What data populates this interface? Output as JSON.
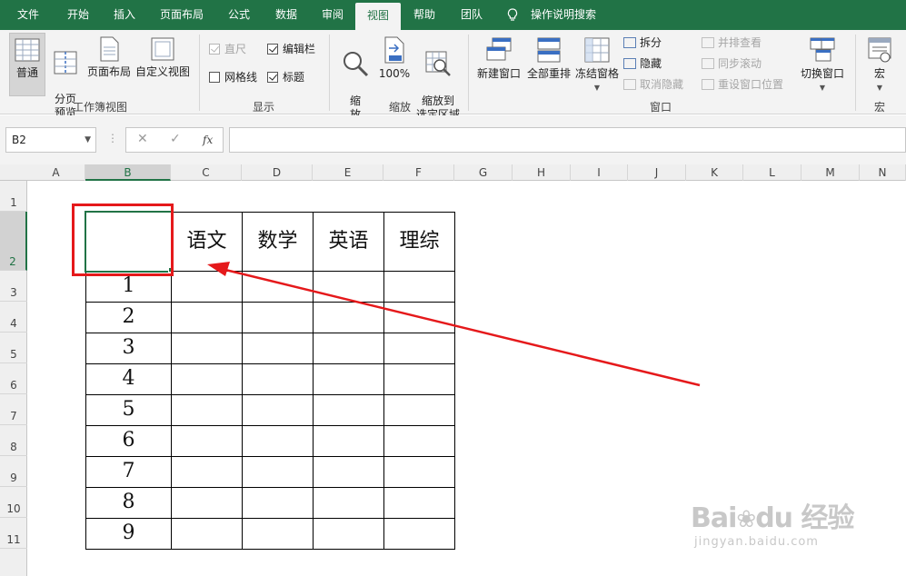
{
  "tabs": [
    {
      "label": "文件"
    },
    {
      "label": "开始"
    },
    {
      "label": "插入"
    },
    {
      "label": "页面布局"
    },
    {
      "label": "公式"
    },
    {
      "label": "数据"
    },
    {
      "label": "审阅"
    },
    {
      "label": "视图"
    },
    {
      "label": "帮助"
    },
    {
      "label": "团队"
    }
  ],
  "active_tab": "视图",
  "tell_me": "操作说明搜索",
  "ribbon": {
    "workbook_views": {
      "label": "工作簿视图",
      "normal": "普通",
      "page_break_preview": "分页\n预览",
      "page_layout": "页面布局",
      "custom_views": "自定义视图"
    },
    "show": {
      "label": "显示",
      "ruler": "直尺",
      "formula_bar": "编辑栏",
      "gridlines": "网格线",
      "headings": "标题"
    },
    "zoom": {
      "label": "缩放",
      "zoom": "缩\n放",
      "hundred": "100%",
      "zoom_to_selection": "缩放到\n选定区域"
    },
    "window": {
      "label": "窗口",
      "new_window": "新建窗口",
      "arrange_all": "全部重排",
      "freeze_panes": "冻结窗格",
      "split": "拆分",
      "hide": "隐藏",
      "unhide": "取消隐藏",
      "side_by_side": "并排查看",
      "sync_scroll": "同步滚动",
      "reset_position": "重设窗口位置",
      "switch_windows": "切换窗口"
    },
    "macros": {
      "label": "宏",
      "macros": "宏"
    }
  },
  "formula_bar": {
    "name_box": "B2",
    "cancel": "✕",
    "enter": "✓",
    "fx": "fx",
    "value": ""
  },
  "columns": [
    "A",
    "B",
    "C",
    "D",
    "E",
    "F",
    "G",
    "H",
    "I",
    "J",
    "K",
    "L",
    "M",
    "N"
  ],
  "rows": [
    "1",
    "2",
    "3",
    "4",
    "5",
    "6",
    "7",
    "8",
    "9",
    "10",
    "11"
  ],
  "selected_cell": "B2",
  "table": {
    "header": [
      "",
      "语文",
      "数学",
      "英语",
      "理综"
    ],
    "row_labels": [
      "1",
      "2",
      "3",
      "4",
      "5",
      "6",
      "7",
      "8",
      "9"
    ]
  },
  "watermark": {
    "brand_a": "Bai",
    "brand_b": "经验",
    "url": "jingyan.baidu.com"
  },
  "colors": {
    "excel_green": "#217346",
    "annotation_red": "#e5191b"
  }
}
